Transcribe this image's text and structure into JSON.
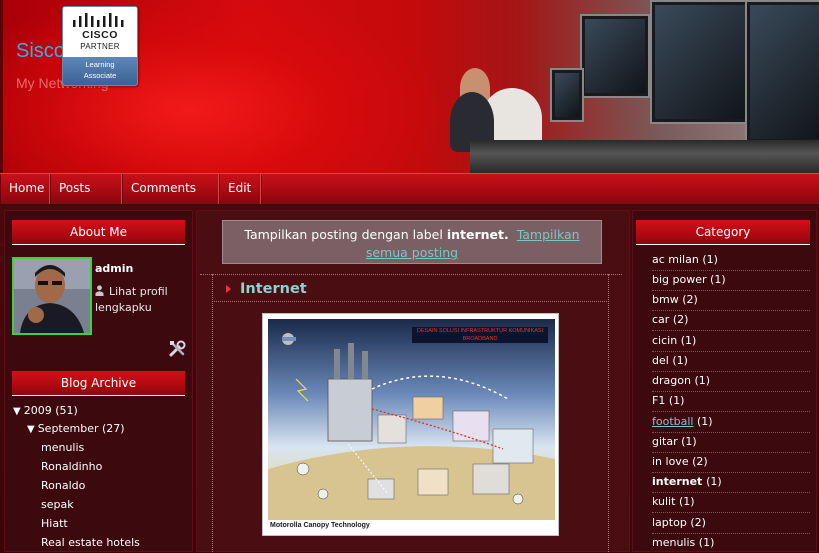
{
  "header": {
    "site_title": "Sisco",
    "site_description": "My Networking",
    "logo": {
      "brand": "CISCO",
      "partner": "PARTNER",
      "line1": "Learning",
      "line2": "Associate"
    }
  },
  "nav": {
    "items": [
      "Home",
      "Posts RSS",
      "Comments RSS",
      "Edit"
    ]
  },
  "sidebar_left": {
    "about_title": "About Me",
    "admin_name": "admin",
    "profile_link": "Lihat profil lengkapku",
    "archive_title": "Blog Archive",
    "archive": {
      "year": "2009",
      "year_count": "(51)",
      "month": "September",
      "month_count": "(27)",
      "posts": [
        "menulis",
        "Ronaldinho",
        "Ronaldo",
        "sepak",
        "Hiatt",
        "Real estate hotels"
      ]
    }
  },
  "main": {
    "label_prefix": "Tampilkan posting dengan label",
    "label_name": "internet.",
    "show_all": "Tampilkan semua posting",
    "post_title": "Internet",
    "image_caption": "Motorolla Canopy Technology",
    "image_banner": "DESAIN SOLUSI INFRASTRUKTUR KOMUNIKASI BROADBAND"
  },
  "sidebar_right": {
    "category_title": "Category",
    "categories": [
      {
        "label": "ac milan",
        "count": "(1)"
      },
      {
        "label": "big power",
        "count": "(1)"
      },
      {
        "label": "bmw",
        "count": "(2)"
      },
      {
        "label": "car",
        "count": "(2)"
      },
      {
        "label": "cicin",
        "count": "(1)"
      },
      {
        "label": "del",
        "count": "(1)"
      },
      {
        "label": "dragon",
        "count": "(1)"
      },
      {
        "label": "F1",
        "count": "(1)"
      },
      {
        "label": "football",
        "count": "(1)"
      },
      {
        "label": "gitar",
        "count": "(1)"
      },
      {
        "label": "in love",
        "count": "(2)"
      },
      {
        "label": "internet",
        "count": "(1)"
      },
      {
        "label": "kulit",
        "count": "(1)"
      },
      {
        "label": "laptop",
        "count": "(2)"
      },
      {
        "label": "menulis",
        "count": "(1)"
      }
    ]
  },
  "icons": {
    "profile": "person-icon",
    "tools": "tools-icon",
    "expand": "triangle-down-icon",
    "post_bullet": "arrow-right-icon"
  },
  "colors": {
    "header_red": "#d40a0e",
    "nav_red": "#a80a12",
    "widget_title_red": "#c40c14",
    "link_teal": "#7fc4c4",
    "title_blue": "#4aa3e8",
    "avatar_border": "#3bd23b"
  }
}
